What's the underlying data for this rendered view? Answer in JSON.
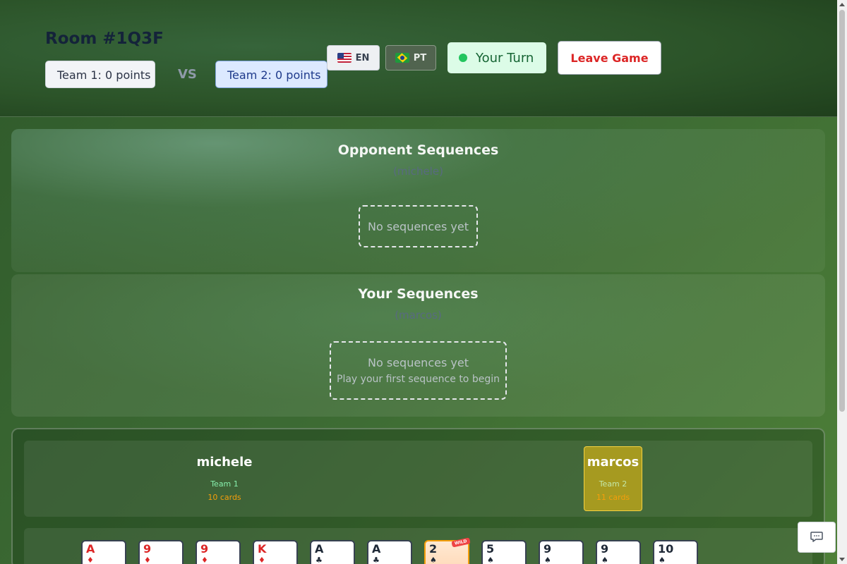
{
  "header": {
    "room_title": "Room #1Q3F",
    "team1_score": "Team 1: 0 points",
    "vs_label": "VS",
    "team2_score": "Team 2: 0 points",
    "lang_en": "EN",
    "lang_pt": "PT",
    "turn_status": "Your Turn",
    "leave_label": "Leave Game"
  },
  "opponent_panel": {
    "title": "Opponent Sequences",
    "player": "(michele)",
    "empty": "No sequences yet"
  },
  "your_panel": {
    "title": "Your Sequences",
    "player": "(marcos)",
    "empty": "No sequences yet",
    "hint": "Play your first sequence to begin"
  },
  "players": [
    {
      "name": "michele",
      "team": "Team 1",
      "cards": "10 cards",
      "active": false
    },
    {
      "name": "marcos",
      "team": "Team 2",
      "cards": "11 cards",
      "active": true
    }
  ],
  "hand": [
    {
      "rank": "A",
      "suit": "♦",
      "color": "red"
    },
    {
      "rank": "9",
      "suit": "♦",
      "color": "red"
    },
    {
      "rank": "9",
      "suit": "♦",
      "color": "red"
    },
    {
      "rank": "K",
      "suit": "♦",
      "color": "red"
    },
    {
      "rank": "A",
      "suit": "♣",
      "color": "black"
    },
    {
      "rank": "A",
      "suit": "♣",
      "color": "black"
    },
    {
      "rank": "2",
      "suit": "♠",
      "color": "black",
      "wild": true,
      "wild_label": "WILD"
    },
    {
      "rank": "5",
      "suit": "♠",
      "color": "black"
    },
    {
      "rank": "9",
      "suit": "♠",
      "color": "black"
    },
    {
      "rank": "9",
      "suit": "♠",
      "color": "black"
    },
    {
      "rank": "10",
      "suit": "♠",
      "color": "black"
    }
  ],
  "colors": {
    "turn_indicator": "#22c55e",
    "leave_text": "#dc2626",
    "active_player_bg": "#a69a20",
    "wild_badge": "#ef4444"
  },
  "icons": {
    "chat": "chat-bubble-icon"
  }
}
